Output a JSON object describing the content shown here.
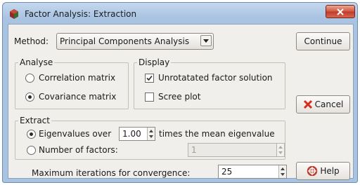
{
  "window": {
    "title": "Factor Analysis: Extraction"
  },
  "method": {
    "label": "Method:",
    "selected": "Principal Components Analysis"
  },
  "analyse": {
    "title": "Analyse",
    "options": [
      {
        "label": "Correlation matrix",
        "selected": false
      },
      {
        "label": "Covariance matrix",
        "selected": true
      }
    ]
  },
  "display": {
    "title": "Display",
    "options": [
      {
        "label": "Unrotatated factor solution",
        "checked": true
      },
      {
        "label": "Scree plot",
        "checked": false
      }
    ]
  },
  "extract": {
    "title": "Extract",
    "eigen_label": "Eigenvalues over",
    "eigen_value": "1.00",
    "eigen_suffix": "times the mean eigenvalue",
    "eigen_selected": true,
    "factors_label": "Number of factors:",
    "factors_value": "1",
    "factors_selected": false
  },
  "iterations": {
    "label": "Maximum iterations for convergence:",
    "value": "25"
  },
  "buttons": {
    "continue": "Continue",
    "cancel": "Cancel",
    "help": "Help"
  },
  "colors": {
    "cancel_icon": "#d92b1c",
    "help_icon": "#c0392b",
    "close_button": "#c0392b"
  }
}
